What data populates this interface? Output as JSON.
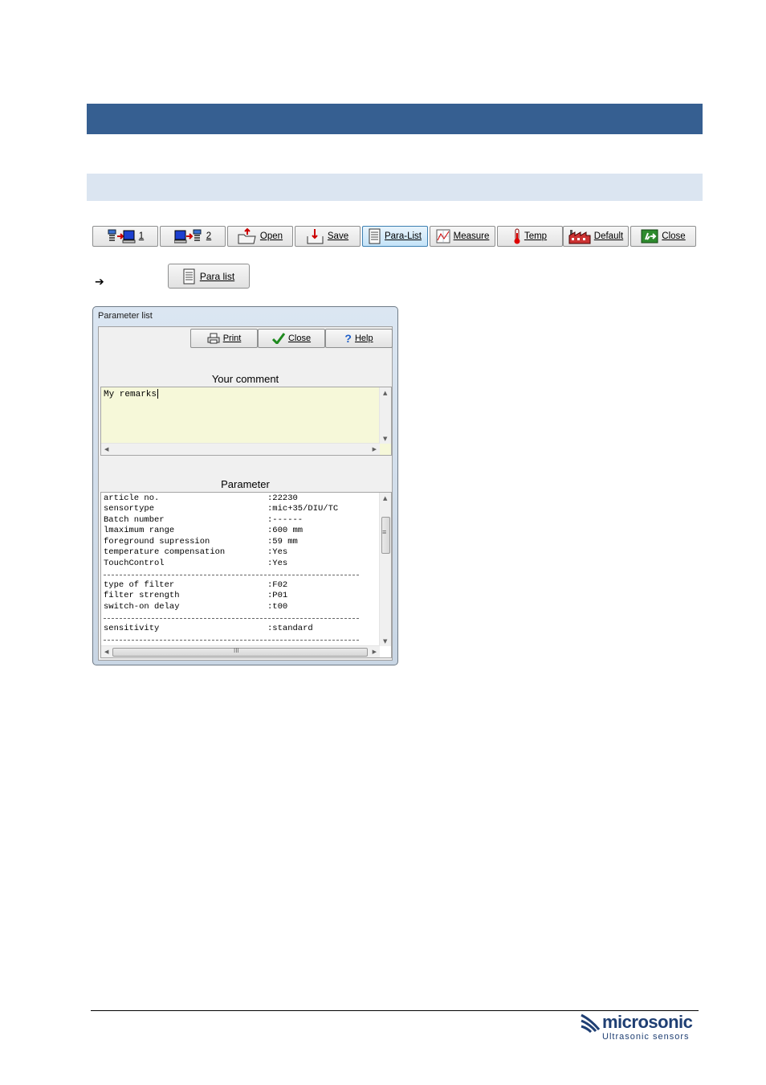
{
  "toolbar": {
    "buttons": [
      {
        "label": "1"
      },
      {
        "label": "2"
      },
      {
        "label": "Open"
      },
      {
        "label": "Save"
      },
      {
        "label": "Para-List"
      },
      {
        "label": "Measure"
      },
      {
        "label": "Temp"
      },
      {
        "label": "Default"
      },
      {
        "label": "Close"
      }
    ]
  },
  "step_arrow": "➔",
  "paralist_button": {
    "label": "Para list"
  },
  "dialog": {
    "title": "Parameter list",
    "buttons": {
      "print": "Print",
      "close": "Close",
      "help": "Help"
    },
    "comment_heading": "Your comment",
    "comment_text": "My remarks",
    "parameter_heading": "Parameter",
    "parameters": [
      {
        "key": "article no.",
        "value": ":22230"
      },
      {
        "key": "sensortype",
        "value": ":mic+35/DIU/TC"
      },
      {
        "key": "Batch number",
        "value": ":------"
      },
      {
        "key": "lmaximum range",
        "value": ":600 mm"
      },
      {
        "key": "foreground supression",
        "value": ":59 mm"
      },
      {
        "key": "temperature compensation",
        "value": ":Yes"
      },
      {
        "key": "TouchControl",
        "value": ":Yes"
      },
      {
        "key": "type of filter",
        "value": ":F02"
      },
      {
        "key": "filter strength",
        "value": ":P01"
      },
      {
        "key": "switch-on delay",
        "value": ":t00"
      },
      {
        "key": "sensitivity",
        "value": ":standard"
      }
    ],
    "hscroll_grip": "III",
    "vscroll_grip": "≡"
  },
  "logo": {
    "name": "microsonic",
    "tagline": "Ultrasonic sensors"
  }
}
